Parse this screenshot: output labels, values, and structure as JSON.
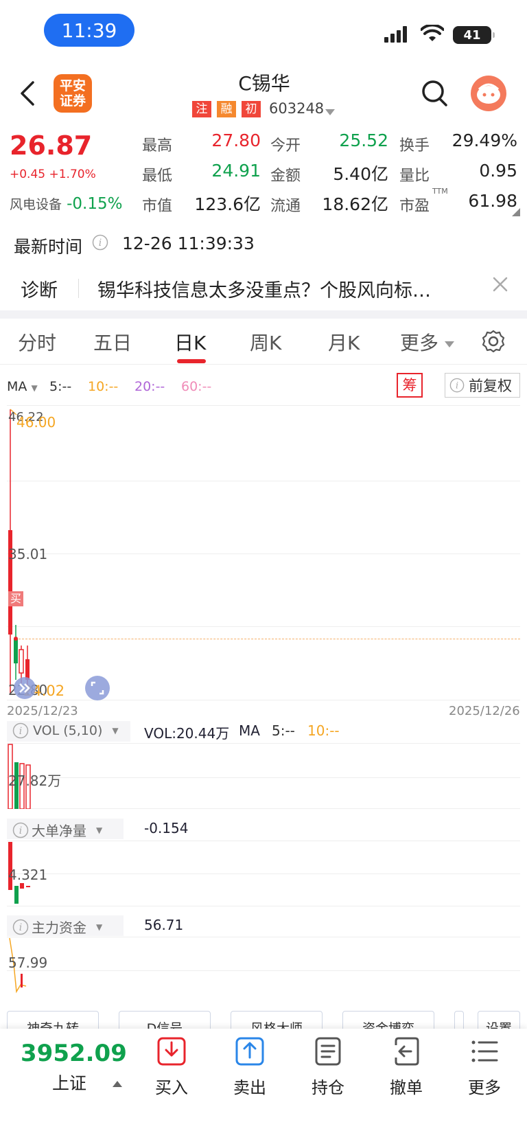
{
  "status_bar": {
    "time": "11:39",
    "battery": "41"
  },
  "header": {
    "logo_line1": "平安",
    "logo_line2": "证券",
    "title": "C锡华",
    "tags": [
      "注",
      "融",
      "初"
    ],
    "code": "603248"
  },
  "quote": {
    "price": "26.87",
    "change": "+0.45 +1.70%",
    "sector_name": "风电设备",
    "sector_change": "-0.15%",
    "high_label": "最高",
    "high": "27.80",
    "open_label": "今开",
    "open": "25.52",
    "turnover_label": "换手",
    "turnover": "29.49%",
    "low_label": "最低",
    "low": "24.91",
    "amount_label": "金额",
    "amount": "5.40亿",
    "vol_ratio_label": "量比",
    "vol_ratio": "0.95",
    "mktcap_label": "市值",
    "mktcap": "123.6亿",
    "float_label": "流通",
    "float": "18.62亿",
    "pe_label": "市盈",
    "pe_sup": "TTM",
    "pe": "61.98"
  },
  "latest": {
    "label": "最新时间",
    "value": "12-26 11:39:33"
  },
  "diagnosis": {
    "label": "诊断",
    "text": "锡华科技信息太多没重点？个股风向标…"
  },
  "tabs": [
    "分时",
    "五日",
    "日K",
    "周K",
    "月K",
    "更多"
  ],
  "ma_bar": {
    "label": "MA",
    "ma5": "5:--",
    "ma10": "10:--",
    "ma20": "20:--",
    "ma60": "60:--",
    "chip": "筹",
    "adjust": "前复权"
  },
  "kline": {
    "top_label": "46.22",
    "top_value": "46.00",
    "mid_label": "35.01",
    "bottom_label": "22.80",
    "bottom_value": "24.02",
    "buy_tag": "买",
    "date_start": "2025/12/23",
    "date_end": "2025/12/26"
  },
  "volume": {
    "label": "VOL (5,10)",
    "value": "VOL:20.44万",
    "ma": "MA",
    "ma5": "5:--",
    "ma10": "10:--",
    "axis": "27.82万"
  },
  "big_order": {
    "label": "大单净量",
    "value": "-0.154",
    "axis": "4.321"
  },
  "main_fund": {
    "label": "主力资金",
    "value": "56.71",
    "axis": "57.99"
  },
  "indicators": [
    "神奇九转",
    "D信号",
    "风格大师",
    "资金博弈",
    "设置"
  ],
  "bottom": {
    "index_value": "3952.09",
    "index_name": "上证",
    "buttons": [
      "买入",
      "卖出",
      "持仓",
      "撤单",
      "更多"
    ]
  },
  "colors": {
    "up": "#e8242c",
    "down": "#0fa14d",
    "accent": "#1f6ef2"
  }
}
